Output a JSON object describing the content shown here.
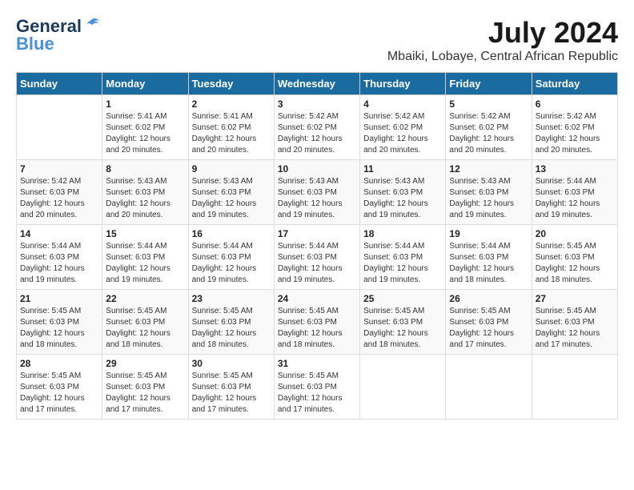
{
  "header": {
    "logo_general": "General",
    "logo_blue": "Blue",
    "month_year": "July 2024",
    "location": "Mbaiki, Lobaye, Central African Republic"
  },
  "days_of_week": [
    "Sunday",
    "Monday",
    "Tuesday",
    "Wednesday",
    "Thursday",
    "Friday",
    "Saturday"
  ],
  "weeks": [
    [
      {
        "day": "",
        "info": ""
      },
      {
        "day": "1",
        "info": "Sunrise: 5:41 AM\nSunset: 6:02 PM\nDaylight: 12 hours\nand 20 minutes."
      },
      {
        "day": "2",
        "info": "Sunrise: 5:41 AM\nSunset: 6:02 PM\nDaylight: 12 hours\nand 20 minutes."
      },
      {
        "day": "3",
        "info": "Sunrise: 5:42 AM\nSunset: 6:02 PM\nDaylight: 12 hours\nand 20 minutes."
      },
      {
        "day": "4",
        "info": "Sunrise: 5:42 AM\nSunset: 6:02 PM\nDaylight: 12 hours\nand 20 minutes."
      },
      {
        "day": "5",
        "info": "Sunrise: 5:42 AM\nSunset: 6:02 PM\nDaylight: 12 hours\nand 20 minutes."
      },
      {
        "day": "6",
        "info": "Sunrise: 5:42 AM\nSunset: 6:02 PM\nDaylight: 12 hours\nand 20 minutes."
      }
    ],
    [
      {
        "day": "7",
        "info": "Sunrise: 5:42 AM\nSunset: 6:03 PM\nDaylight: 12 hours\nand 20 minutes."
      },
      {
        "day": "8",
        "info": "Sunrise: 5:43 AM\nSunset: 6:03 PM\nDaylight: 12 hours\nand 20 minutes."
      },
      {
        "day": "9",
        "info": "Sunrise: 5:43 AM\nSunset: 6:03 PM\nDaylight: 12 hours\nand 19 minutes."
      },
      {
        "day": "10",
        "info": "Sunrise: 5:43 AM\nSunset: 6:03 PM\nDaylight: 12 hours\nand 19 minutes."
      },
      {
        "day": "11",
        "info": "Sunrise: 5:43 AM\nSunset: 6:03 PM\nDaylight: 12 hours\nand 19 minutes."
      },
      {
        "day": "12",
        "info": "Sunrise: 5:43 AM\nSunset: 6:03 PM\nDaylight: 12 hours\nand 19 minutes."
      },
      {
        "day": "13",
        "info": "Sunrise: 5:44 AM\nSunset: 6:03 PM\nDaylight: 12 hours\nand 19 minutes."
      }
    ],
    [
      {
        "day": "14",
        "info": "Sunrise: 5:44 AM\nSunset: 6:03 PM\nDaylight: 12 hours\nand 19 minutes."
      },
      {
        "day": "15",
        "info": "Sunrise: 5:44 AM\nSunset: 6:03 PM\nDaylight: 12 hours\nand 19 minutes."
      },
      {
        "day": "16",
        "info": "Sunrise: 5:44 AM\nSunset: 6:03 PM\nDaylight: 12 hours\nand 19 minutes."
      },
      {
        "day": "17",
        "info": "Sunrise: 5:44 AM\nSunset: 6:03 PM\nDaylight: 12 hours\nand 19 minutes."
      },
      {
        "day": "18",
        "info": "Sunrise: 5:44 AM\nSunset: 6:03 PM\nDaylight: 12 hours\nand 19 minutes."
      },
      {
        "day": "19",
        "info": "Sunrise: 5:44 AM\nSunset: 6:03 PM\nDaylight: 12 hours\nand 18 minutes."
      },
      {
        "day": "20",
        "info": "Sunrise: 5:45 AM\nSunset: 6:03 PM\nDaylight: 12 hours\nand 18 minutes."
      }
    ],
    [
      {
        "day": "21",
        "info": "Sunrise: 5:45 AM\nSunset: 6:03 PM\nDaylight: 12 hours\nand 18 minutes."
      },
      {
        "day": "22",
        "info": "Sunrise: 5:45 AM\nSunset: 6:03 PM\nDaylight: 12 hours\nand 18 minutes."
      },
      {
        "day": "23",
        "info": "Sunrise: 5:45 AM\nSunset: 6:03 PM\nDaylight: 12 hours\nand 18 minutes."
      },
      {
        "day": "24",
        "info": "Sunrise: 5:45 AM\nSunset: 6:03 PM\nDaylight: 12 hours\nand 18 minutes."
      },
      {
        "day": "25",
        "info": "Sunrise: 5:45 AM\nSunset: 6:03 PM\nDaylight: 12 hours\nand 18 minutes."
      },
      {
        "day": "26",
        "info": "Sunrise: 5:45 AM\nSunset: 6:03 PM\nDaylight: 12 hours\nand 17 minutes."
      },
      {
        "day": "27",
        "info": "Sunrise: 5:45 AM\nSunset: 6:03 PM\nDaylight: 12 hours\nand 17 minutes."
      }
    ],
    [
      {
        "day": "28",
        "info": "Sunrise: 5:45 AM\nSunset: 6:03 PM\nDaylight: 12 hours\nand 17 minutes."
      },
      {
        "day": "29",
        "info": "Sunrise: 5:45 AM\nSunset: 6:03 PM\nDaylight: 12 hours\nand 17 minutes."
      },
      {
        "day": "30",
        "info": "Sunrise: 5:45 AM\nSunset: 6:03 PM\nDaylight: 12 hours\nand 17 minutes."
      },
      {
        "day": "31",
        "info": "Sunrise: 5:45 AM\nSunset: 6:03 PM\nDaylight: 12 hours\nand 17 minutes."
      },
      {
        "day": "",
        "info": ""
      },
      {
        "day": "",
        "info": ""
      },
      {
        "day": "",
        "info": ""
      }
    ]
  ]
}
